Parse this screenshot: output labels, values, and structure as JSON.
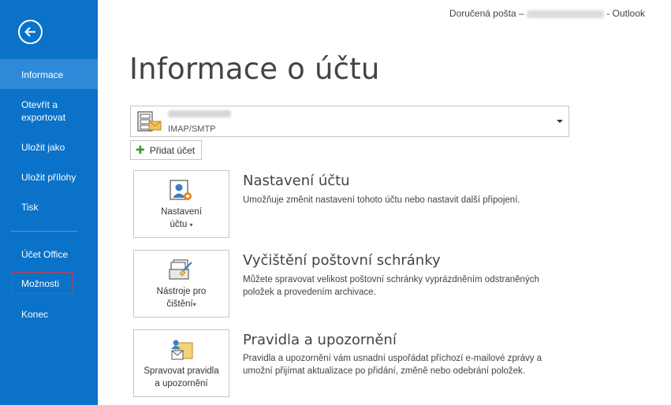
{
  "window": {
    "title_prefix": "Doručená pošta – ",
    "title_suffix": " - Outlook"
  },
  "sidebar": {
    "items": [
      {
        "label": "Informace"
      },
      {
        "label": "Otevřít a exportovat"
      },
      {
        "label": "Uložit jako"
      },
      {
        "label": "Uložit přílohy"
      },
      {
        "label": "Tisk"
      },
      {
        "label": "Účet Office"
      },
      {
        "label": "Možnosti"
      },
      {
        "label": "Konec"
      }
    ]
  },
  "main": {
    "title": "Informace o účtu",
    "account": {
      "type": "IMAP/SMTP"
    },
    "add_account_label": "Přidat účet",
    "sections": [
      {
        "button_line1": "Nastavení",
        "button_line2": "účtu",
        "title": "Nastavení účtu",
        "description": "Umožňuje změnit nastavení tohoto účtu nebo nastavit další připojení."
      },
      {
        "button_line1": "Nástroje pro",
        "button_line2": "čištění",
        "title": "Vyčištění poštovní schránky",
        "description": "Můžete spravovat velikost poštovní schránky vyprázdněním odstraněných položek a provedením archivace."
      },
      {
        "button_line1": "Spravovat pravidla",
        "button_line2": "a upozornění",
        "title": "Pravidla a upozornění",
        "description": "Pravidla a upozornění vám usnadní uspořádat příchozí e-mailové zprávy a umožní přijímat aktualizace po přidání, změně nebo odebrání položek."
      }
    ]
  },
  "colors": {
    "sidebar_bg": "#0a72c9",
    "sidebar_active": "#2e8ad9",
    "highlight_box": "#e0343a"
  }
}
